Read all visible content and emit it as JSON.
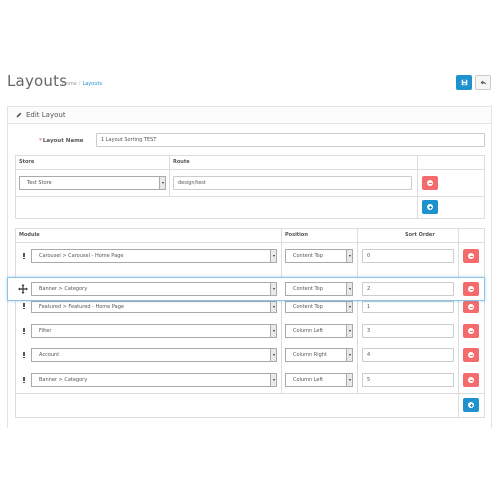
{
  "header": {
    "title": "Layouts",
    "breadcrumb": [
      {
        "label": "Home"
      },
      {
        "label": "Layouts"
      }
    ],
    "breadcrumb_sep": "/"
  },
  "panel": {
    "heading": "Edit Layout"
  },
  "form": {
    "layout_name_label": "Layout Name",
    "layout_name_value": "1 Layout Sorting TEST"
  },
  "route_table": {
    "headers": {
      "store": "Store",
      "route": "Route"
    },
    "rows": [
      {
        "store": "Test Store",
        "route": "design/test"
      }
    ]
  },
  "module_table": {
    "headers": {
      "module": "Module",
      "position": "Position",
      "sort_order": "Sort Order"
    },
    "rows": [
      {
        "module": "Carousel > Carousel - Home Page",
        "position": "Content Top",
        "sort": "0"
      },
      {
        "module": "Featured > Featured - Home Page",
        "position": "Content Top",
        "sort": "1"
      },
      {
        "module": "Filter",
        "position": "Column Left",
        "sort": "3"
      },
      {
        "module": "Account",
        "position": "Column Right",
        "sort": "4"
      },
      {
        "module": "Banner > Category",
        "position": "Column Left",
        "sort": "5"
      }
    ],
    "dragging_row": {
      "module": "Banner > Category",
      "position": "Content Top",
      "sort": "2"
    }
  },
  "colors": {
    "primary": "#1e91cf",
    "danger": "#f56b6b",
    "drag_outline": "#8ec3e6"
  },
  "icons": {
    "save": "save-icon",
    "back": "reply-icon",
    "edit": "pencil-icon",
    "drag": "move-icon",
    "remove": "minus-circle-icon",
    "add": "plus-circle-icon"
  }
}
